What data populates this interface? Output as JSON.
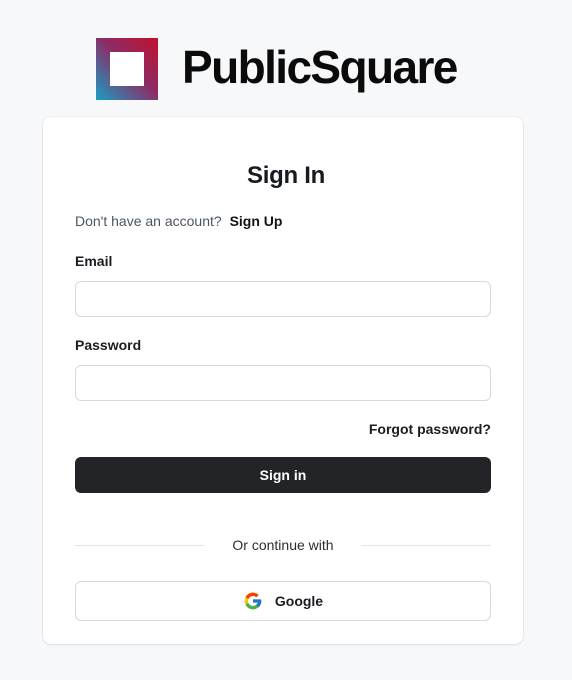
{
  "brand": {
    "name": "PublicSquare",
    "logo_icon": "square-frame-logo-icon"
  },
  "auth": {
    "title": "Sign In",
    "signup_prompt": "Don't have an account?",
    "signup_link": "Sign Up",
    "email_label": "Email",
    "email_value": "",
    "email_placeholder": "",
    "password_label": "Password",
    "password_value": "",
    "password_placeholder": "",
    "forgot_link": "Forgot password?",
    "submit_label": "Sign in",
    "divider_text": "Or continue with",
    "google_label": "Google",
    "google_icon": "google-icon"
  },
  "colors": {
    "background": "#f7f8fa",
    "card": "#ffffff",
    "primary_button": "#232427",
    "logo_gradient_start": "#c1122e",
    "logo_gradient_end": "#1a9ec5"
  }
}
